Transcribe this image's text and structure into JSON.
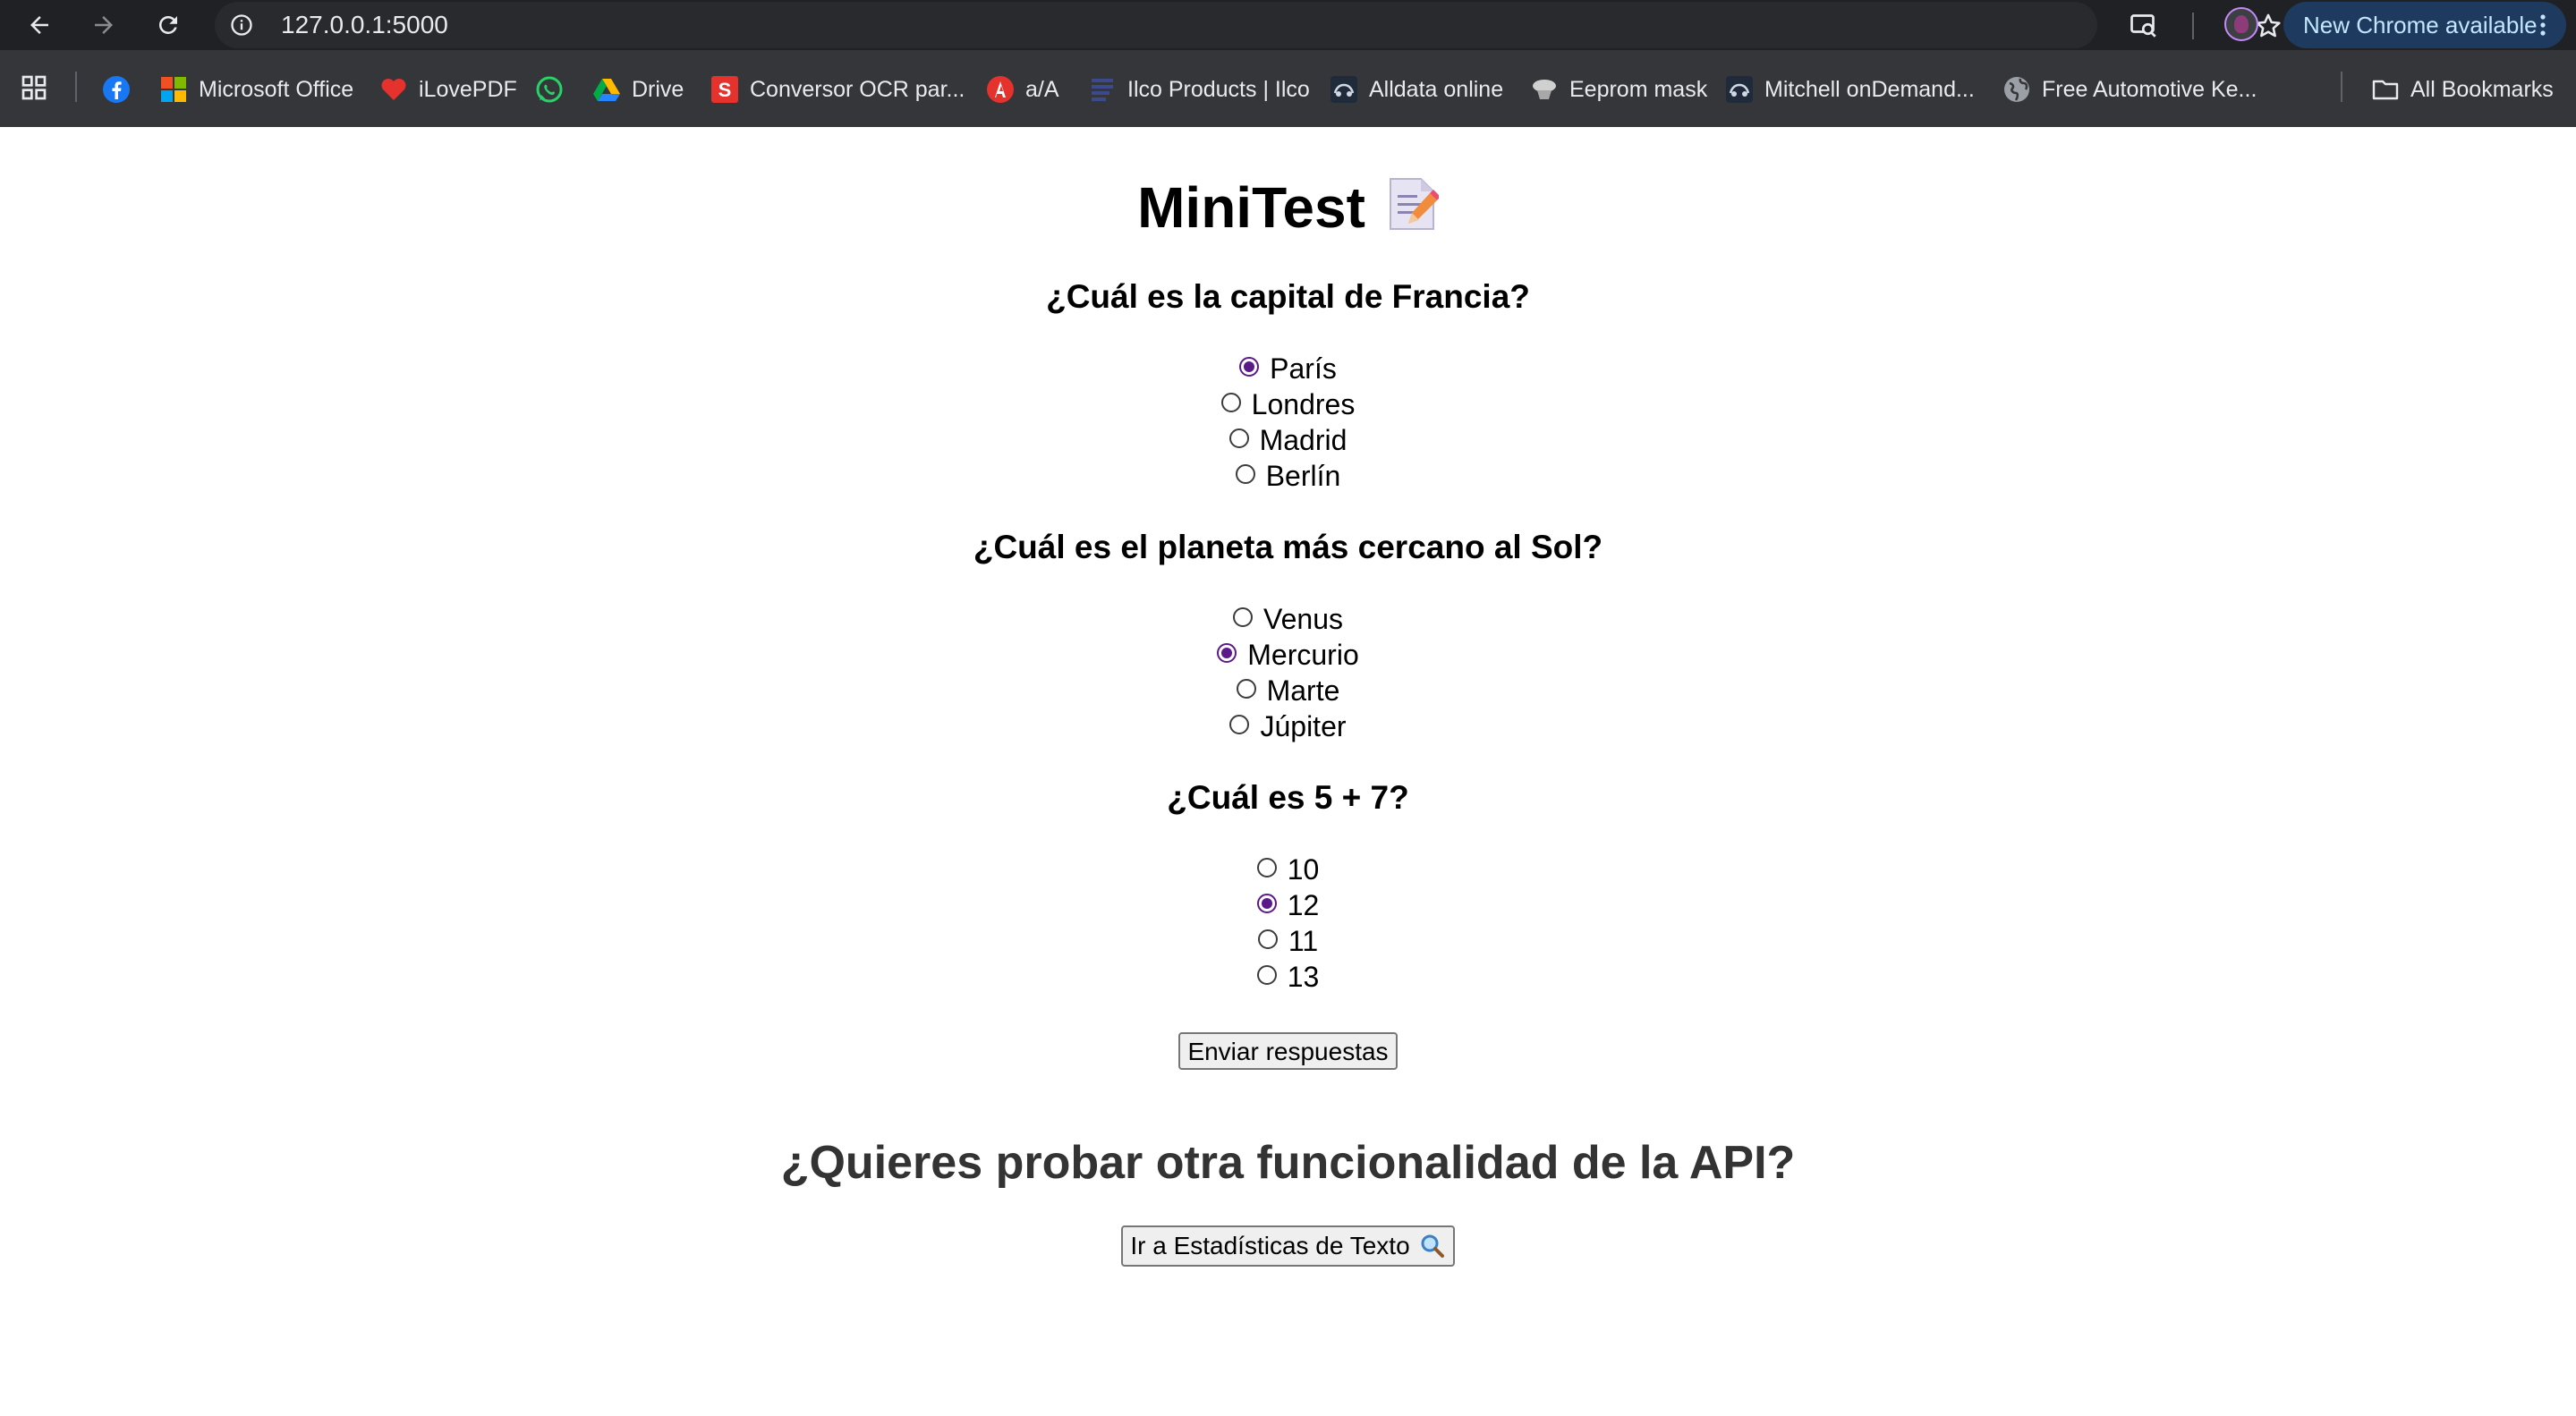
{
  "browser": {
    "url": "127.0.0.1:5000",
    "update_label": "New Chrome available"
  },
  "bookmarks": [
    {
      "label": "",
      "icon": "facebook-icon"
    },
    {
      "label": "Microsoft Office",
      "icon": "microsoft-office-icon"
    },
    {
      "label": "iLovePDF",
      "icon": "ilovepdf-icon"
    },
    {
      "label": "",
      "icon": "whatsapp-icon"
    },
    {
      "label": "Drive",
      "icon": "google-drive-icon"
    },
    {
      "label": "Conversor OCR par...",
      "icon": "ocr-converter-icon"
    },
    {
      "label": "a/A",
      "icon": "text-case-icon"
    },
    {
      "label": "Ilco Products | Ilco",
      "icon": "ilco-icon"
    },
    {
      "label": "Alldata online",
      "icon": "alldata-icon"
    },
    {
      "label": "Eeprom mask",
      "icon": "eeprom-icon"
    },
    {
      "label": "Mitchell onDemand...",
      "icon": "mitchell-icon"
    },
    {
      "label": "Free Automotive Ke...",
      "icon": "globe-icon"
    },
    {
      "label": "All Bookmarks",
      "icon": "folder-icon"
    }
  ],
  "page": {
    "title": "MiniTest",
    "questions": [
      {
        "text": "¿Cuál es la capital de Francia?",
        "options": [
          "París",
          "Londres",
          "Madrid",
          "Berlín"
        ],
        "selected": "París"
      },
      {
        "text": "¿Cuál es el planeta más cercano al Sol?",
        "options": [
          "Venus",
          "Mercurio",
          "Marte",
          "Júpiter"
        ],
        "selected": "Mercurio"
      },
      {
        "text": "¿Cuál es 5 + 7?",
        "options": [
          "10",
          "12",
          "11",
          "13"
        ],
        "selected": "12"
      }
    ],
    "submit_label": "Enviar respuestas",
    "subheading": "¿Quieres probar otra funcionalidad de la API?",
    "stats_button_label": "Ir a Estadísticas de Texto"
  },
  "colors": {
    "radio_checked": "#5b1a8a",
    "topbar": "#202124",
    "bookmarks_bar": "#35363a"
  }
}
